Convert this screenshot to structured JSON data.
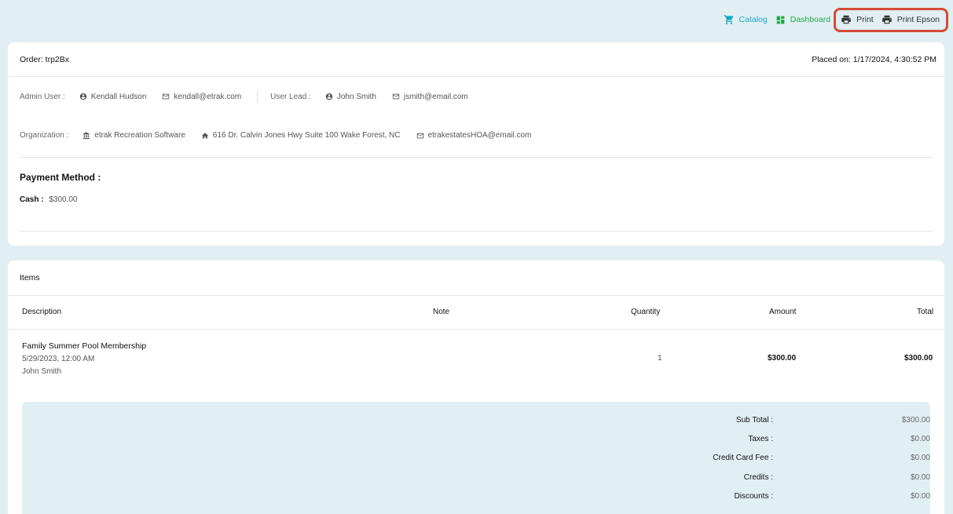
{
  "nav": {
    "catalog": "Catalog",
    "dashboard": "Dashboard",
    "print": "Print",
    "print_epson": "Print Epson"
  },
  "order": {
    "title": "Order: trp2Bx",
    "placed_on": "Placed on: 1/17/2024, 4:30:52 PM",
    "admin_label": "Admin User :",
    "admin_name": "Kendall Hudson",
    "admin_email": "kendall@etrak.com",
    "lead_label": "User Lead :",
    "lead_name": "John Smith",
    "lead_email": "jsmith@email.com",
    "org_label": "Organization :",
    "org_name": "etrak Recreation Software",
    "org_address": "616 Dr. Calvin Jones Hwy Suite 100 Wake Forest, NC",
    "org_email": "etrakestatesHOA@email.com",
    "payment_title": "Payment Method :",
    "payment_type": "Cash :",
    "payment_amount": "$300.00"
  },
  "items": {
    "title": "Items",
    "headers": {
      "description": "Description",
      "note": "Note",
      "quantity": "Quantity",
      "amount": "Amount",
      "total": "Total"
    },
    "rows": [
      {
        "name": "Family Summer Pool Membership",
        "date": "5/29/2023, 12:00 AM",
        "person": "John Smith",
        "note": "",
        "quantity": "1",
        "amount": "$300.00",
        "total": "$300.00"
      }
    ]
  },
  "summary": {
    "subtotal_label": "Sub Total :",
    "subtotal": "$300.00",
    "taxes_label": "Taxes :",
    "taxes": "$0.00",
    "ccfee_label": "Credit Card Fee :",
    "ccfee": "$0.00",
    "credits_label": "Credits :",
    "credits": "$0.00",
    "discounts_label": "Discounts :",
    "discounts": "$0.00"
  },
  "colors": {
    "background": "#e1eff3",
    "catalog": "#1aa6c4",
    "dashboard": "#1faa4b",
    "highlight": "#d64a3a"
  },
  "icons": [
    "cart-icon",
    "dashboard-icon",
    "printer-icon",
    "person-icon",
    "mail-icon",
    "bank-icon",
    "home-icon"
  ]
}
